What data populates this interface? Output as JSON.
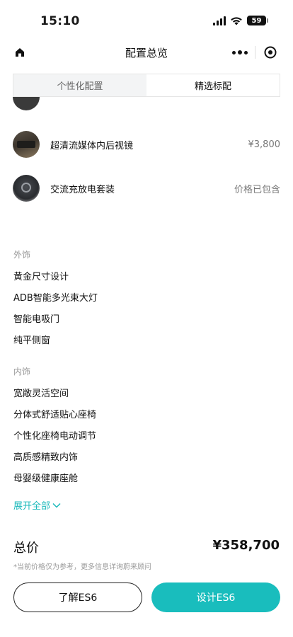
{
  "status_bar": {
    "time": "15:10",
    "battery": "59"
  },
  "nav": {
    "title": "配置总览"
  },
  "tabs": [
    {
      "label": "个性化配置",
      "active": false
    },
    {
      "label": "精选标配",
      "active": true
    }
  ],
  "equipment": [
    {
      "name": "超清流媒体内后视镜",
      "price": "¥3,800"
    },
    {
      "name": "交流充放电套装",
      "price": "价格已包含"
    }
  ],
  "exterior": {
    "title": "外饰",
    "items": [
      "黄金尺寸设计",
      "ADB智能多光束大灯",
      "智能电吸门",
      "纯平侧窗"
    ]
  },
  "interior": {
    "title": "内饰",
    "items": [
      "宽敞灵活空间",
      "分体式舒适贴心座椅",
      "个性化座椅电动调节",
      "高质感精致内饰",
      "母婴级健康座舱"
    ]
  },
  "expand_label": "展开全部",
  "footer": {
    "total_label": "总价",
    "total_price": "¥358,700",
    "disclaimer": "*当前价格仅为参考，更多信息详询蔚来顾问",
    "learn_button": "了解ES6",
    "design_button": "设计ES6"
  },
  "colors": {
    "accent": "#19bdbd",
    "text": "#111111",
    "muted": "#999999"
  },
  "icons": [
    "home-icon",
    "more-dots-icon",
    "close-target-icon",
    "chevron-down-icon",
    "signal-icon",
    "wifi-icon",
    "battery-icon"
  ]
}
